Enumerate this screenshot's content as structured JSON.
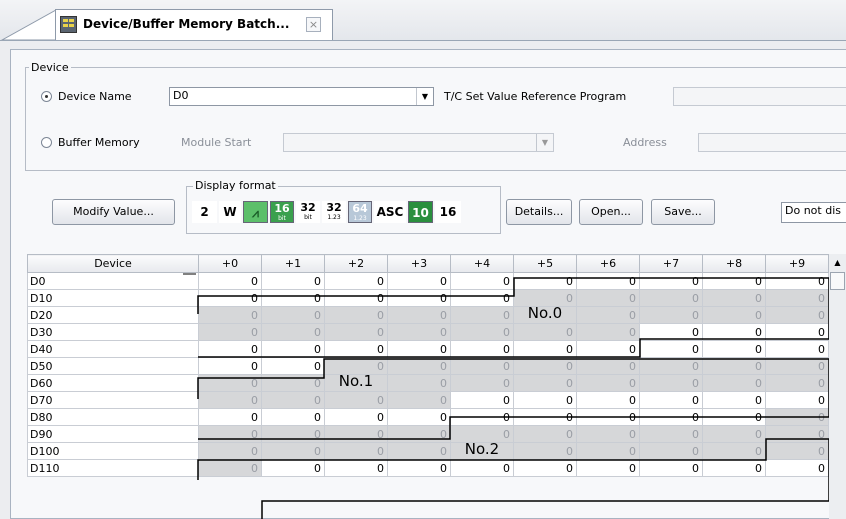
{
  "tab": {
    "title": "Device/Buffer Memory Batch...",
    "close": "×"
  },
  "device_group": {
    "legend": "Device",
    "device_name_radio": {
      "label": "Device Name",
      "selected": true
    },
    "device_name_value": "D0",
    "tc_label": "T/C Set Value Reference Program",
    "buffer_memory_radio": {
      "label": "Buffer Memory",
      "selected": false
    },
    "module_start_label": "Module Start",
    "address_label": "Address"
  },
  "toolbar": {
    "modify_value_label": "Modify Value...",
    "display_format_legend": "Display format",
    "formats": [
      {
        "text": "2",
        "bg": "#ffffff",
        "fg": "#000000"
      },
      {
        "text": "W",
        "bg": "#ffffff",
        "fg": "#000000"
      },
      {
        "text": "⩘",
        "bg": "#5cbf6a",
        "fg": "#1a5d28"
      },
      {
        "text": "16",
        "sub": "bit",
        "bg": "#3aa04d",
        "fg": "#ffffff"
      },
      {
        "text": "32",
        "sub": "bit",
        "bg": "#ffffff",
        "fg": "#000000"
      },
      {
        "text": "32",
        "sub": "1.23",
        "bg": "#ffffff",
        "fg": "#000000"
      },
      {
        "text": "64",
        "sub": "1.23",
        "bg": "#b8c8d8",
        "fg": "#ffffff"
      },
      {
        "text": "ASC",
        "bg": "#ffffff",
        "fg": "#000000"
      },
      {
        "text": "10",
        "bg": "#2a8f3e",
        "fg": "#ffffff"
      },
      {
        "text": "16",
        "bg": "#ffffff",
        "fg": "#000000"
      }
    ],
    "details_label": "Details...",
    "open_label": "Open...",
    "save_label": "Save...",
    "display_option": "Do not dis"
  },
  "table": {
    "columns": [
      "Device",
      "+0",
      "+1",
      "+2",
      "+3",
      "+4",
      "+5",
      "+6",
      "+7",
      "+8",
      "+9"
    ],
    "rows": [
      {
        "device": "D0",
        "values": [
          "0",
          "0",
          "0",
          "0",
          "0",
          "0",
          "0",
          "0",
          "0",
          "0"
        ],
        "unused": []
      },
      {
        "device": "D10",
        "values": [
          "0",
          "0",
          "0",
          "0",
          "0",
          "0",
          "0",
          "0",
          "0",
          "0"
        ],
        "unused": [
          5,
          6,
          7,
          8,
          9
        ]
      },
      {
        "device": "D20",
        "values": [
          "0",
          "0",
          "0",
          "0",
          "0",
          "",
          "0",
          "0",
          "0",
          "0"
        ],
        "unused": [
          0,
          1,
          2,
          3,
          4,
          5,
          6,
          7,
          8,
          9
        ],
        "region_label": {
          "col": 5,
          "text": "No.0"
        }
      },
      {
        "device": "D30",
        "values": [
          "0",
          "0",
          "0",
          "0",
          "0",
          "0",
          "0",
          "0",
          "0",
          "0"
        ],
        "unused": [
          0,
          1,
          2,
          3,
          4,
          5,
          6
        ]
      },
      {
        "device": "D40",
        "values": [
          "0",
          "0",
          "0",
          "0",
          "0",
          "0",
          "0",
          "0",
          "0",
          "0"
        ],
        "unused": []
      },
      {
        "device": "D50",
        "values": [
          "0",
          "0",
          "0",
          "0",
          "0",
          "0",
          "0",
          "0",
          "0",
          "0"
        ],
        "unused": [
          2,
          3,
          4,
          5,
          6,
          7,
          8,
          9
        ]
      },
      {
        "device": "D60",
        "values": [
          "0",
          "0",
          "",
          "0",
          "0",
          "0",
          "0",
          "0",
          "0",
          "0"
        ],
        "unused": [
          0,
          1,
          2,
          3,
          4,
          5,
          6,
          7,
          8,
          9
        ],
        "region_label": {
          "col": 2,
          "text": "No.1"
        }
      },
      {
        "device": "D70",
        "values": [
          "0",
          "0",
          "0",
          "0",
          "0",
          "0",
          "0",
          "0",
          "0",
          "0"
        ],
        "unused": [
          0,
          1,
          2,
          3
        ]
      },
      {
        "device": "D80",
        "values": [
          "0",
          "0",
          "0",
          "0",
          "0",
          "0",
          "0",
          "0",
          "0",
          "0"
        ],
        "unused": [
          9
        ]
      },
      {
        "device": "D90",
        "values": [
          "0",
          "0",
          "0",
          "0",
          "0",
          "0",
          "0",
          "0",
          "0",
          "0"
        ],
        "unused": [
          0,
          1,
          2,
          3,
          4,
          5,
          6,
          7,
          8,
          9
        ]
      },
      {
        "device": "D100",
        "values": [
          "0",
          "0",
          "0",
          "0",
          "",
          "0",
          "0",
          "0",
          "0",
          "0"
        ],
        "unused": [
          0,
          1,
          2,
          3,
          4,
          5,
          6,
          7,
          8,
          9
        ],
        "region_label": {
          "col": 4,
          "text": "No.2"
        }
      },
      {
        "device": "D110",
        "values": [
          "0",
          "0",
          "0",
          "0",
          "0",
          "0",
          "0",
          "0",
          "0",
          "0"
        ],
        "unused": [
          0
        ]
      }
    ]
  }
}
